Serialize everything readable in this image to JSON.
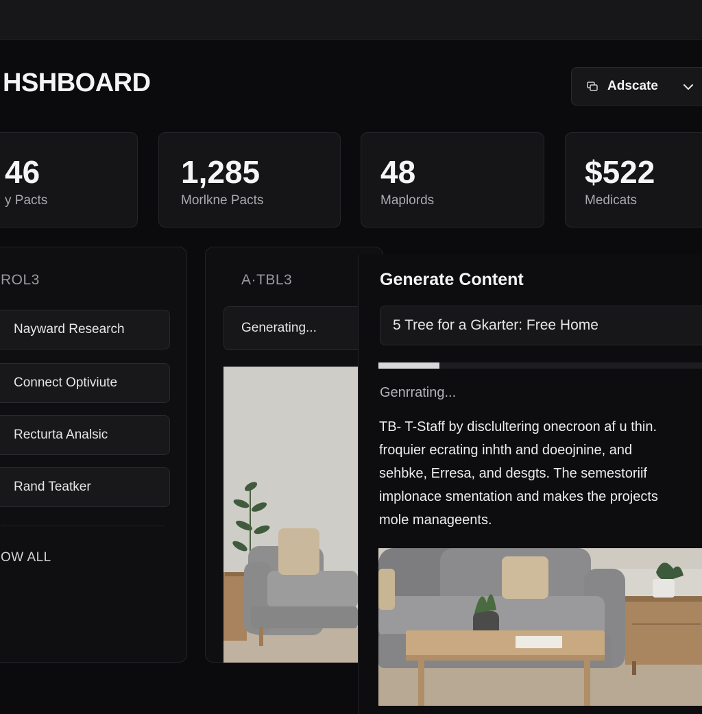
{
  "header": {
    "title": "HSHBOARD",
    "dropdown_label": "Adscate"
  },
  "stats": [
    {
      "value": "46",
      "caption": "y Pacts"
    },
    {
      "value": "1,285",
      "caption": "Morlkne Pacts"
    },
    {
      "value": "48",
      "caption": "Maplords"
    },
    {
      "value": "$522",
      "caption": "Medicats"
    }
  ],
  "tools_panel": {
    "heading": "ROL3",
    "items": [
      "Nayward Research",
      "Connect Optiviute",
      "Recturta Analsic",
      "Rand Teatker"
    ],
    "view_all": "OW ALL"
  },
  "table_panel": {
    "heading": "A·TBL3",
    "generating_label": "Generating..."
  },
  "generate": {
    "title": "Generate Content",
    "prompt_value": "5 Tree for a Gkarter: Free Home",
    "progress": 0.185,
    "status": "Genrrating...",
    "body_lines": [
      "TB- T-Staff by disclultering onecroon af u thin.",
      "froquier ecrating inhth and doeojnine, and",
      "sehbke, Erresa, and desgts. The semestoriif",
      "implonace smentation and makes the projects",
      "mole manageents."
    ]
  },
  "icons": {
    "dropdown_icon": "layers-icon",
    "dropdown_chevron": "chevron-down-icon"
  },
  "colors": {
    "background": "#0b0b0d",
    "card": "#151518",
    "progress": "#d8d8db"
  }
}
